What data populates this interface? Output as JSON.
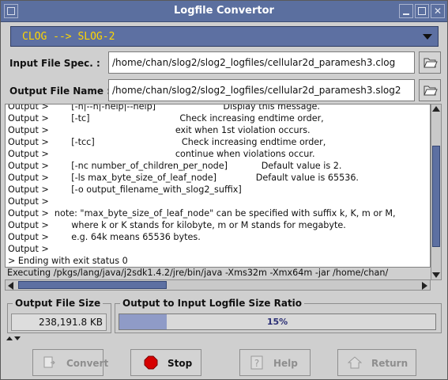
{
  "window": {
    "title": "Logfile Convertor"
  },
  "conversion": {
    "selected": "CLOG --> SLOG-2"
  },
  "input_file": {
    "label": "Input File Spec. :",
    "value": "/home/chan/slog2/slog2_logfiles/cellular2d_paramesh3.clog"
  },
  "output_file": {
    "label": "Output File Name :",
    "value": "/home/chan/slog2/slog2_logfiles/cellular2d_paramesh3.slog2"
  },
  "log": {
    "lines": [
      "Output >        [-h|--h|-help|--help]                        Display this message.",
      "Output >        [-tc]                                Check increasing endtime order,",
      "Output >                                             exit when 1st violation occurs.",
      "Output >        [-tcc]                               Check increasing endtime order,",
      "Output >                                             continue when violations occur.",
      "Output >        [-nc number_of_children_per_node]            Default value is 2.",
      "Output >        [-ls max_byte_size_of_leaf_node]              Default value is 65536.",
      "Output >        [-o output_filename_with_slog2_suffix]",
      "Output >",
      "Output >  note: \"max_byte_size_of_leaf_node\" can be specified with suffix k, K, m or M,",
      "Output >        where k or K stands for kilobyte, m or M stands for megabyte.",
      "Output >        e.g. 64k means 65536 bytes.",
      "Output >",
      "> Ending with exit status 0"
    ],
    "exec": "Executing /pkgs/lang/java/j2sdk1.4.2/jre/bin/java -Xms32m -Xmx64m -jar /home/chan/"
  },
  "stats": {
    "output_size_label": "Output File Size",
    "output_size_value": "238,191.8 KB",
    "ratio_label": "Output to Input Logfile Size Ratio",
    "ratio_text": "15%",
    "ratio_value": 15
  },
  "buttons": {
    "convert": "Convert",
    "stop": "Stop",
    "help": "Help",
    "return": "Return"
  },
  "colors": {
    "titlebar": "#5b6f9f",
    "combo_text": "#ffd700",
    "progress_fill": "#8f9bc7",
    "stop_red": "#d60000"
  }
}
